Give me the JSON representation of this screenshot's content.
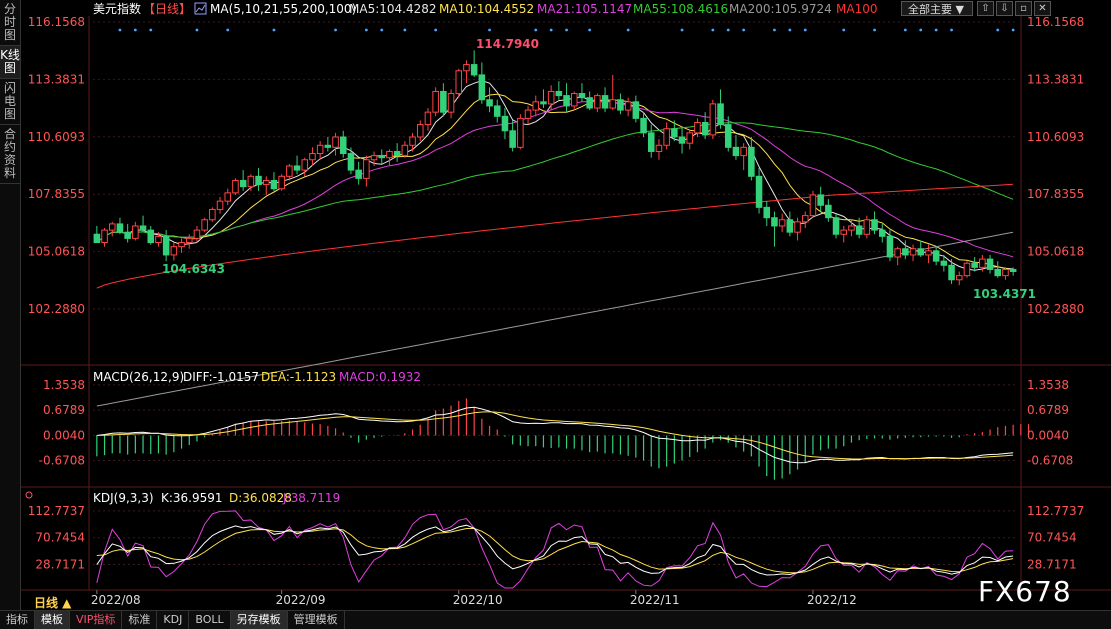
{
  "left_tabs": [
    "分时图",
    "K线图",
    "闪电图",
    "合约资料"
  ],
  "active_left_tab": 1,
  "main_legend": {
    "symbol": "美元指数",
    "period": "【日线】",
    "ma_params": "MA(5,10,21,55,200,100)",
    "items": [
      {
        "label": "MA5:104.4282",
        "color": "#e6e6e6"
      },
      {
        "label": "MA10:104.4552",
        "color": "#ffe24d"
      },
      {
        "label": "MA21:105.1147",
        "color": "#e040e0"
      },
      {
        "label": "MA55:108.4616",
        "color": "#33cc33"
      },
      {
        "label": "MA200:105.9724",
        "color": "#999999"
      },
      {
        "label": "MA100",
        "color": "#ff3333"
      }
    ]
  },
  "period_select": "全部主要 ▼",
  "toolbar_icons": [
    "up-arrow-icon",
    "down-arrow-icon",
    "square-icon",
    "close-icon"
  ],
  "price_axis": [
    "116.1568",
    "113.3831",
    "110.6093",
    "107.8355",
    "105.0618",
    "102.2880"
  ],
  "annotations": {
    "high": "114.7940",
    "low_early": "104.6343",
    "low_late": "103.4371"
  },
  "macd_legend": {
    "params": "MACD(26,12,9)",
    "diff": "DIFF:-1.0157",
    "dea": "DEA:-1.1123",
    "macd": "MACD:0.1932"
  },
  "macd_axis": [
    "1.3538",
    "0.6789",
    "0.0040",
    "-0.6708"
  ],
  "kdj_legend": {
    "params": "KDJ(9,3,3)",
    "k": "K:36.9591",
    "d": "D:36.0828",
    "j": "J:38.7119"
  },
  "kdj_axis": [
    "112.7737",
    "70.7454",
    "28.7171"
  ],
  "date_axis": [
    "2022/08",
    "2022/09",
    "2022/10",
    "2022/11",
    "2022/12"
  ],
  "period_label": "日线 ▲",
  "bottom_tabs": [
    {
      "label": "指标",
      "type": "normal"
    },
    {
      "label": "模板",
      "type": "active"
    },
    {
      "label": "VIP指标",
      "type": "vip"
    },
    {
      "label": "标准",
      "type": "normal"
    },
    {
      "label": "KDJ",
      "type": "normal"
    },
    {
      "label": "BOLL",
      "type": "normal"
    },
    {
      "label": "另存模板",
      "type": "active"
    },
    {
      "label": "管理模板",
      "type": "normal"
    }
  ],
  "watermark": "FX678",
  "colors": {
    "up": "#ff4444",
    "down": "#33d17a",
    "grid": "#3a1a1a"
  },
  "chart_data": {
    "type": "candlestick",
    "candles": [
      [
        105.9,
        106.3,
        105.6,
        105.5
      ],
      [
        105.5,
        106.2,
        105.3,
        106.1
      ],
      [
        106.1,
        106.5,
        105.8,
        106.4
      ],
      [
        106.4,
        106.7,
        105.9,
        106.0
      ],
      [
        106.0,
        106.4,
        105.5,
        105.7
      ],
      [
        105.7,
        106.5,
        105.6,
        106.3
      ],
      [
        106.3,
        106.8,
        106.0,
        106.1
      ],
      [
        106.1,
        106.3,
        105.4,
        105.5
      ],
      [
        105.5,
        106.0,
        105.3,
        105.8
      ],
      [
        105.8,
        106.1,
        104.6,
        104.9
      ],
      [
        104.9,
        105.5,
        104.63,
        105.3
      ],
      [
        105.3,
        105.7,
        105.0,
        105.5
      ],
      [
        105.5,
        105.9,
        105.2,
        105.7
      ],
      [
        105.7,
        106.3,
        105.5,
        106.1
      ],
      [
        106.1,
        106.7,
        106.0,
        106.6
      ],
      [
        106.6,
        107.2,
        106.5,
        107.1
      ],
      [
        107.1,
        107.7,
        106.9,
        107.5
      ],
      [
        107.5,
        108.1,
        107.3,
        107.9
      ],
      [
        107.9,
        108.6,
        107.8,
        108.5
      ],
      [
        108.5,
        109.0,
        108.0,
        108.2
      ],
      [
        108.2,
        108.8,
        108.0,
        108.7
      ],
      [
        108.7,
        109.1,
        108.0,
        108.3
      ],
      [
        108.3,
        108.7,
        107.8,
        108.5
      ],
      [
        108.5,
        108.9,
        108.0,
        108.1
      ],
      [
        108.1,
        108.8,
        108.0,
        108.7
      ],
      [
        108.7,
        109.3,
        108.5,
        109.2
      ],
      [
        109.2,
        109.7,
        108.8,
        109.0
      ],
      [
        109.0,
        109.6,
        108.7,
        109.5
      ],
      [
        109.5,
        110.1,
        109.2,
        109.8
      ],
      [
        109.8,
        110.4,
        109.5,
        110.2
      ],
      [
        110.2,
        110.6,
        109.9,
        110.1
      ],
      [
        110.1,
        110.8,
        109.7,
        110.6
      ],
      [
        110.6,
        110.9,
        109.6,
        109.8
      ],
      [
        109.8,
        110.1,
        108.8,
        109.0
      ],
      [
        109.0,
        109.4,
        108.3,
        108.6
      ],
      [
        108.6,
        109.7,
        108.2,
        109.5
      ],
      [
        109.5,
        109.9,
        109.2,
        109.7
      ],
      [
        109.7,
        110.0,
        109.3,
        109.6
      ],
      [
        109.6,
        110.0,
        109.2,
        109.9
      ],
      [
        109.9,
        110.3,
        109.4,
        109.7
      ],
      [
        109.7,
        110.4,
        109.6,
        110.2
      ],
      [
        110.2,
        110.8,
        109.9,
        110.6
      ],
      [
        110.6,
        111.4,
        110.4,
        111.2
      ],
      [
        111.2,
        112.0,
        110.9,
        111.8
      ],
      [
        111.8,
        113.0,
        111.6,
        112.8
      ],
      [
        112.8,
        113.2,
        111.6,
        111.8
      ],
      [
        111.8,
        112.9,
        111.5,
        112.7
      ],
      [
        112.7,
        113.9,
        112.5,
        113.8
      ],
      [
        113.8,
        114.3,
        113.2,
        114.1
      ],
      [
        114.1,
        114.79,
        113.5,
        113.6
      ],
      [
        113.6,
        114.2,
        112.2,
        112.4
      ],
      [
        112.4,
        113.0,
        111.8,
        112.1
      ],
      [
        112.1,
        112.4,
        111.3,
        111.6
      ],
      [
        111.6,
        112.0,
        110.5,
        110.9
      ],
      [
        110.9,
        111.4,
        109.9,
        110.1
      ],
      [
        110.1,
        111.7,
        110.0,
        111.5
      ],
      [
        111.5,
        112.1,
        111.2,
        111.9
      ],
      [
        111.9,
        112.6,
        111.6,
        112.3
      ],
      [
        112.3,
        112.9,
        112.0,
        112.2
      ],
      [
        112.2,
        113.1,
        111.9,
        112.8
      ],
      [
        112.8,
        113.3,
        112.4,
        112.6
      ],
      [
        112.6,
        113.2,
        111.8,
        112.1
      ],
      [
        112.1,
        112.8,
        111.9,
        112.7
      ],
      [
        112.7,
        113.2,
        112.3,
        112.5
      ],
      [
        112.5,
        112.8,
        111.9,
        112.0
      ],
      [
        112.0,
        112.7,
        111.8,
        112.6
      ],
      [
        112.6,
        113.0,
        111.8,
        112.0
      ],
      [
        112.0,
        113.6,
        111.9,
        112.4
      ],
      [
        112.4,
        112.7,
        111.7,
        111.9
      ],
      [
        111.9,
        112.5,
        111.6,
        112.3
      ],
      [
        112.3,
        112.6,
        111.3,
        111.5
      ],
      [
        111.5,
        111.8,
        110.6,
        110.8
      ],
      [
        110.8,
        111.2,
        109.6,
        109.9
      ],
      [
        109.9,
        110.5,
        109.5,
        110.2
      ],
      [
        110.2,
        111.3,
        110.0,
        111.0
      ],
      [
        111.0,
        111.4,
        110.4,
        110.6
      ],
      [
        110.6,
        111.1,
        109.8,
        110.3
      ],
      [
        110.3,
        110.9,
        110.0,
        110.8
      ],
      [
        110.8,
        111.5,
        110.6,
        111.3
      ],
      [
        111.3,
        111.8,
        110.5,
        110.7
      ],
      [
        110.7,
        112.4,
        110.5,
        112.2
      ],
      [
        112.2,
        112.9,
        111.0,
        111.2
      ],
      [
        111.2,
        111.6,
        109.9,
        110.1
      ],
      [
        110.1,
        110.7,
        109.5,
        109.7
      ],
      [
        109.7,
        110.3,
        109.0,
        110.1
      ],
      [
        110.1,
        110.6,
        108.5,
        108.7
      ],
      [
        108.7,
        109.1,
        106.9,
        107.2
      ],
      [
        107.2,
        107.5,
        106.3,
        106.7
      ],
      [
        106.7,
        107.0,
        105.3,
        106.3
      ],
      [
        106.3,
        106.9,
        106.0,
        106.6
      ],
      [
        106.6,
        107.0,
        105.8,
        106.0
      ],
      [
        106.0,
        106.7,
        105.6,
        106.5
      ],
      [
        106.5,
        107.0,
        106.2,
        106.8
      ],
      [
        106.8,
        108.0,
        106.7,
        107.8
      ],
      [
        107.8,
        108.2,
        107.0,
        107.3
      ],
      [
        107.3,
        107.6,
        106.5,
        106.7
      ],
      [
        106.7,
        106.9,
        105.7,
        105.9
      ],
      [
        105.9,
        106.3,
        105.5,
        106.1
      ],
      [
        106.1,
        106.6,
        105.8,
        106.3
      ],
      [
        106.3,
        106.7,
        105.7,
        105.9
      ],
      [
        105.9,
        106.8,
        105.7,
        106.6
      ],
      [
        106.6,
        107.0,
        105.9,
        106.1
      ],
      [
        106.1,
        106.4,
        105.5,
        105.8
      ],
      [
        105.8,
        106.1,
        104.6,
        104.8
      ],
      [
        104.8,
        105.3,
        104.4,
        105.2
      ],
      [
        105.2,
        105.6,
        104.7,
        104.9
      ],
      [
        104.9,
        105.4,
        104.6,
        105.2
      ],
      [
        105.2,
        105.6,
        104.8,
        104.9
      ],
      [
        104.9,
        105.4,
        104.5,
        105.1
      ],
      [
        105.1,
        105.3,
        104.4,
        104.6
      ],
      [
        104.6,
        104.9,
        104.1,
        104.4
      ],
      [
        104.4,
        104.7,
        103.5,
        103.7
      ],
      [
        103.7,
        104.1,
        103.44,
        103.9
      ],
      [
        103.9,
        104.6,
        103.8,
        104.5
      ],
      [
        104.5,
        104.8,
        104.1,
        104.3
      ],
      [
        104.3,
        104.9,
        104.1,
        104.7
      ],
      [
        104.7,
        104.9,
        104.0,
        104.2
      ],
      [
        104.2,
        104.6,
        103.8,
        103.9
      ],
      [
        103.9,
        104.3,
        103.7,
        104.2
      ],
      [
        104.2,
        104.3,
        103.9,
        104.1
      ]
    ],
    "macd_hist": [
      -0.35,
      -0.33,
      -0.3,
      -0.3,
      -0.32,
      -0.3,
      -0.3,
      -0.31,
      -0.3,
      -0.32,
      -0.28,
      -0.22,
      -0.16,
      -0.1,
      -0.03,
      0.03,
      0.09,
      0.14,
      0.2,
      0.22,
      0.24,
      0.24,
      0.24,
      0.24,
      0.24,
      0.25,
      0.24,
      0.22,
      0.2,
      0.19,
      0.16,
      0.12,
      0.05,
      -0.04,
      -0.12,
      -0.07,
      -0.04,
      -0.02,
      0.0,
      0.01,
      0.04,
      0.1,
      0.18,
      0.28,
      0.42,
      0.45,
      0.5,
      0.58,
      0.62,
      0.48,
      0.28,
      0.16,
      0.1,
      -0.02,
      -0.15,
      -0.17,
      -0.18,
      -0.18,
      -0.2,
      -0.21,
      -0.2,
      -0.22,
      -0.22,
      -0.25,
      -0.28,
      -0.27,
      -0.3,
      -0.3,
      -0.32,
      -0.34,
      -0.37,
      -0.42,
      -0.52,
      -0.55,
      -0.52,
      -0.47,
      -0.42,
      -0.36,
      -0.28,
      -0.22,
      -0.12,
      -0.08,
      -0.12,
      -0.2,
      -0.27,
      -0.35,
      -0.52,
      -0.68,
      -0.74,
      -0.72,
      -0.65,
      -0.57,
      -0.46,
      -0.32,
      -0.25,
      -0.22,
      -0.22,
      -0.18,
      -0.12,
      -0.08,
      -0.06,
      -0.05,
      -0.05,
      -0.07,
      -0.05,
      -0.04,
      -0.03,
      -0.03,
      -0.02,
      -0.02,
      -0.02,
      -0.04,
      -0.03,
      0.02,
      0.04,
      0.06,
      0.1,
      0.14,
      0.16,
      0.18,
      0.19,
      0.19
    ],
    "macd_y_range": [
      -1.3,
      1.7
    ],
    "kdj_y_range": [
      -8,
      122
    ]
  }
}
